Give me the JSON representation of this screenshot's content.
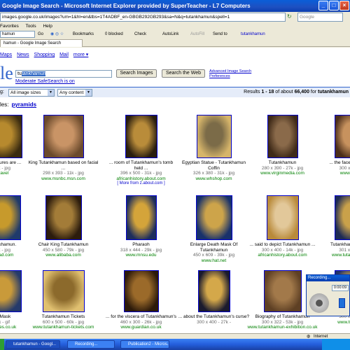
{
  "window": {
    "title": "Google Image Search - Microsoft Internet Explorer provided by SuperTeacher - L7 Computers",
    "min": "_",
    "max": "□",
    "close": "×"
  },
  "address": {
    "url": "images.google.co.uk/images?um=1&hl=en&tbs=1T4ADBF_en-GBGB292GB293&sa=N&q=tutankhamun&spell=1",
    "search_placeholder": "Google"
  },
  "menu": [
    "Favorites",
    "Tools",
    "Help"
  ],
  "toolbar": {
    "search_value": "hamun",
    "go": "Go",
    "bookmarks": "Bookmarks",
    "blocked": "0 blocked",
    "check": "Check",
    "autolink": "AutoLink",
    "autofill": "AutoFill",
    "sendto": "Send to",
    "term": "tutankhamun"
  },
  "tab": {
    "label": "hamun - Google Image Search"
  },
  "google": {
    "nav": [
      "Maps",
      "News",
      "Shopping",
      "Mail",
      "more ▾"
    ],
    "logo": "le",
    "query_prefix": "tu",
    "query_selected": "tankhamun",
    "search_images": "Search Images",
    "search_web": "Search the Web",
    "advanced": "Advanced Image Search",
    "preferences": "Preferences",
    "safesearch": "Moderate SafeSearch is on",
    "size_label": "g:",
    "size_value": "All image sizes",
    "content_value": "Any content",
    "results_prefix": "Results ",
    "results_range": "1 - 18",
    "results_mid": " of about ",
    "results_total": "66,400",
    "results_for": " for ",
    "results_term": "tutankhamun",
    "related_label": "les:",
    "related_link": "pyramids"
  },
  "images": [
    {
      "cap": "n's treasures are ...",
      "meta": "30k - jpg",
      "site": "r.travel",
      "more": ""
    },
    {
      "cap": "King Tutankhamun based on facial ...",
      "meta": "298 x 393 - 11k - jpg",
      "site": "www.msnbc.msn.com",
      "more": ""
    },
    {
      "cap": "... room of Tutankhamun's tomb held ...",
      "meta": "396 x 500 - 31k - jpg",
      "site": "africanhistory.about.com",
      "more": "[ More from z.about.com ]"
    },
    {
      "cap": "Egyptian Statue - Tutankhamun Coffin",
      "meta": "326 x 380 - 31k - jpg",
      "site": "www.whshop.com",
      "more": ""
    },
    {
      "cap": "Tutankhamun",
      "meta": "280 x 390 - 27k - jpg",
      "site": "www.virginmedia.com",
      "more": ""
    },
    {
      "cap": "... the face c Tutankh",
      "meta": "300 x 411 -",
      "site": "www.smh.",
      "more": ""
    },
    {
      "cap": "Tutankhamun.",
      "meta": "73k - jpg",
      "site": "veread.com",
      "more": ""
    },
    {
      "cap": "Chair King Tutankhamun",
      "meta": "450 x 580 - 79k - jpg",
      "site": "www.alibaba.com",
      "more": ""
    },
    {
      "cap": "Pharaoh",
      "meta": "318 x 444 - 29k - jpg",
      "site": "www.mnsu.edu",
      "more": ""
    },
    {
      "cap": "Enlarge Death Mask Of Tutankhamun",
      "meta": "450 x 609 - 39k - jpg",
      "site": "www.hat.net",
      "more": ""
    },
    {
      "cap": "... said to depict Tutankhamun ...",
      "meta": "300 x 400 - 14k - jpg",
      "site": "africanhistory.about.com",
      "more": ""
    },
    {
      "cap": "Tutankhamun's well",
      "meta": "301 x 465 -",
      "site": "www.tutankhamun",
      "more": ""
    },
    {
      "cap": "n's Mask",
      "meta": "74k - gif",
      "site": "coaches.co.uk",
      "more": ""
    },
    {
      "cap": "Tutankhamun Tickets",
      "meta": "600 x 500 - 60k - jpg",
      "site": "www.tutankhamun-tickets.com",
      "more": ""
    },
    {
      "cap": "... for the viscera of Tutankhamun's",
      "meta": "460 x 300 - 26k - jpg",
      "site": "www.guardian.co.uk",
      "more": ""
    },
    {
      "cap": "... about the Tutankhamun's curse?",
      "meta": "300 x 400 - 27k -",
      "site": "",
      "more": ""
    },
    {
      "cap": "Biography of Tutankhamun",
      "meta": "300 x 322 - 53k - jpg",
      "site": "www.tutankhamun-exhibition.co.uk",
      "more": ""
    },
    {
      "cap": "",
      "meta": "300 x 352 -",
      "site": "www.tutankh",
      "more": ""
    }
  ],
  "recorder": {
    "title": "Recording...",
    "time": "0:00:09"
  },
  "status": {
    "zone": "Internet"
  },
  "taskbar": [
    "tutankhamun - Googl...",
    "Recording...",
    "Publication2 - Micros..."
  ]
}
